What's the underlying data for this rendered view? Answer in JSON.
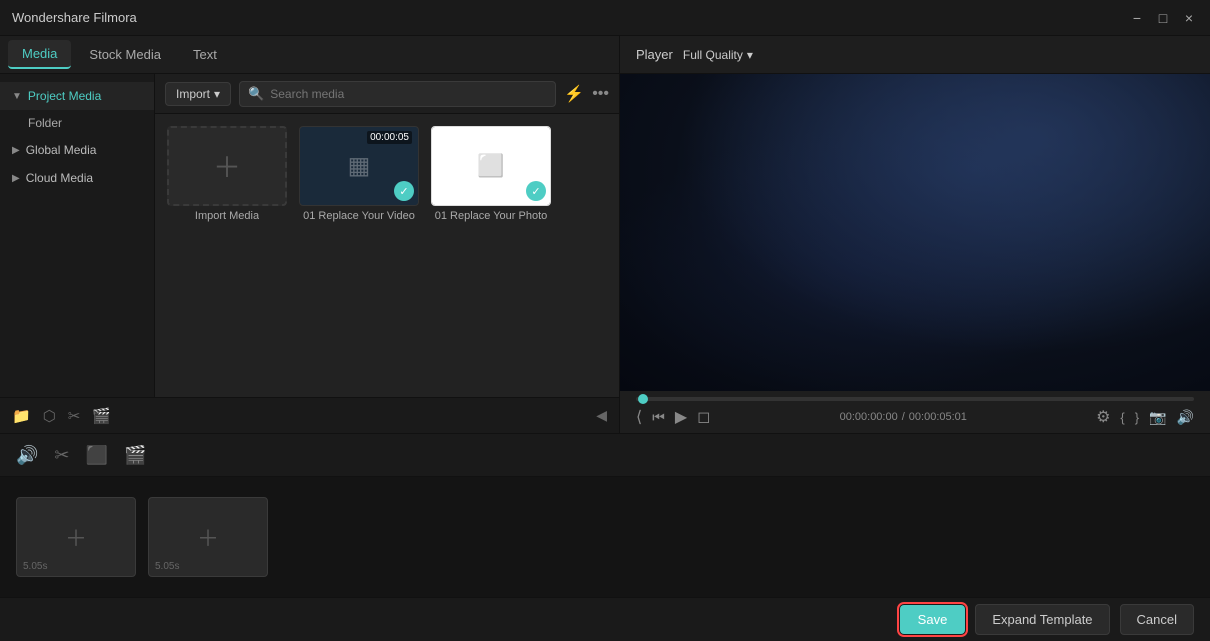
{
  "app": {
    "title": "Wondershare Filmora"
  },
  "titlebar": {
    "title": "Wondershare Filmora",
    "minimize_label": "−",
    "maximize_label": "□",
    "close_label": "×"
  },
  "tabs": [
    {
      "id": "media",
      "label": "Media",
      "active": true
    },
    {
      "id": "stock-media",
      "label": "Stock Media",
      "active": false
    },
    {
      "id": "text",
      "label": "Text",
      "active": false
    }
  ],
  "sidebar": {
    "items": [
      {
        "id": "project-media",
        "label": "Project Media",
        "active": true,
        "arrow": "▼"
      },
      {
        "id": "folder",
        "label": "Folder",
        "sub": true
      },
      {
        "id": "global-media",
        "label": "Global Media",
        "active": false,
        "arrow": "▶"
      },
      {
        "id": "cloud-media",
        "label": "Cloud Media",
        "active": false,
        "arrow": "▶"
      }
    ]
  },
  "media_toolbar": {
    "import_label": "Import",
    "search_placeholder": "Search media",
    "filter_icon": "filter",
    "more_icon": "more"
  },
  "media_items": [
    {
      "id": "import",
      "type": "import",
      "label": "Import Media",
      "thumb_type": "placeholder"
    },
    {
      "id": "video1",
      "type": "video",
      "label": "01 Replace Your Video",
      "duration": "00:00:05",
      "checked": true
    },
    {
      "id": "photo1",
      "type": "photo",
      "label": "01 Replace Your Photo",
      "checked": true
    }
  ],
  "player": {
    "label": "Player",
    "quality_label": "Full Quality",
    "current_time": "00:00:00:00",
    "total_time": "00:00:05:01"
  },
  "controls": {
    "step_back": "⟨",
    "frame_back": "⋘",
    "play": "▶",
    "square": "□",
    "settings": "⚙",
    "bracket_left": "{",
    "bracket_right": "}",
    "camera": "📷",
    "volume": "🔊"
  },
  "edit_toolbar": {
    "tools": [
      "audio",
      "cut",
      "crop",
      "motion"
    ]
  },
  "timeline": {
    "clips": [
      {
        "id": "clip1",
        "duration": "5.05s"
      },
      {
        "id": "clip2",
        "duration": "5.05s"
      }
    ]
  },
  "bottom_bar": {
    "save_label": "Save",
    "expand_label": "Expand Template",
    "cancel_label": "Cancel"
  }
}
